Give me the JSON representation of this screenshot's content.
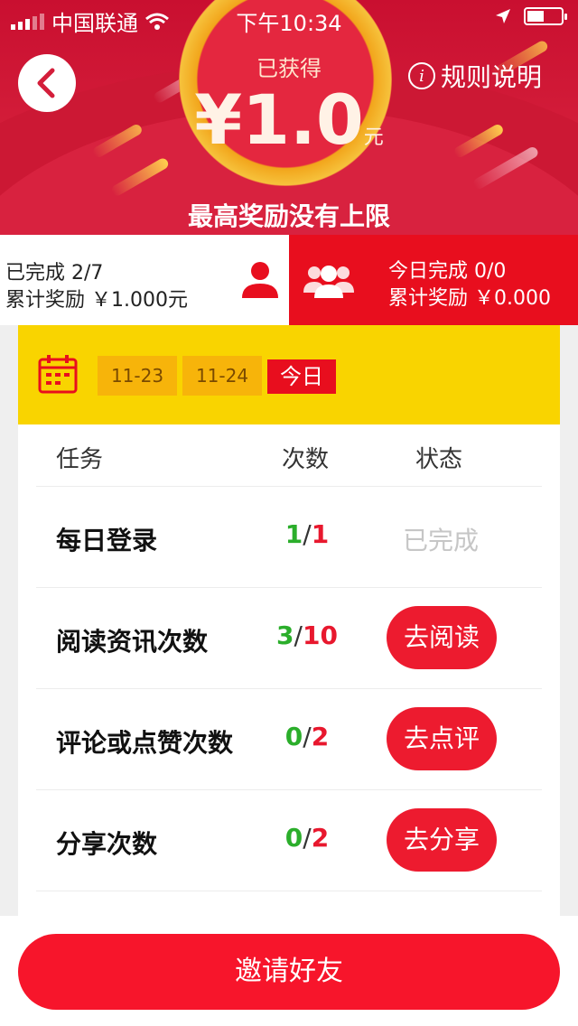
{
  "status_bar": {
    "carrier": "中国联通",
    "time": "下午10:34"
  },
  "header": {
    "earned_label": "已获得",
    "amount": "¥1.0",
    "amount_unit": "元",
    "slogan": "最高奖励没有上限",
    "rules_label": "规则说明",
    "colors": {
      "primary": "#d41e3a",
      "accent": "#f6c23c"
    }
  },
  "stats": {
    "left": {
      "completed": "已完成 2/7",
      "total_reward": "累计奖励 ￥1.000元"
    },
    "right": {
      "completed": "今日完成 0/0",
      "total_reward": "累计奖励 ￥0.000"
    }
  },
  "dates": {
    "d1": "11-23",
    "d2": "11-24",
    "today": "今日"
  },
  "table": {
    "headers": {
      "task": "任务",
      "count": "次数",
      "status": "状态"
    },
    "rows": [
      {
        "name": "每日登录",
        "done": "1",
        "sep": "/",
        "total": "1",
        "status": "已完成"
      },
      {
        "name": "阅读资讯次数",
        "done": "3",
        "sep": "/",
        "total": "10",
        "action": "去阅读"
      },
      {
        "name": "评论或点赞次数",
        "done": "0",
        "sep": "/",
        "total": "2",
        "action": "去点评"
      },
      {
        "name": "分享次数",
        "done": "0",
        "sep": "/",
        "total": "2",
        "action": "去分享"
      }
    ]
  },
  "footer": {
    "invite_label": "邀请好友"
  },
  "icons": [
    "signal-icon",
    "wifi-icon",
    "location-icon",
    "battery-icon",
    "back-icon",
    "info-icon",
    "person-icon",
    "group-icon",
    "calendar-icon"
  ]
}
